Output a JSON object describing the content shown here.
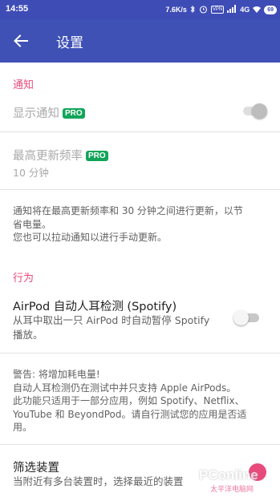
{
  "status_bar": {
    "time": "14:55",
    "net_speed": "7.6K/s",
    "vpn": "VPN",
    "network": "4G",
    "battery": "69"
  },
  "app_bar": {
    "title": "设置"
  },
  "sections": {
    "notifications": {
      "header": "通知",
      "show_notification": {
        "label": "显示通知",
        "badge": "PRO",
        "enabled": false
      },
      "max_frequency": {
        "label": "最高更新频率",
        "badge": "PRO",
        "value": "10 分钟"
      },
      "note_lines": [
        "通知将在最高更新频率和 30 分钟之间进行更新，以节",
        "省电量。",
        "您也可以拉动通知以进行手动更新。"
      ]
    },
    "behavior": {
      "header": "行为",
      "airpod_ear_detect": {
        "label": "AirPod 自动人耳检测 (Spotify)",
        "description_lines": [
          "从耳中取出一只 AirPod 时自动暂停 Spotify",
          "播放。"
        ],
        "checked": false
      },
      "warning_lines": [
        "警告: 将增加耗电量!",
        "自动人耳检测仍在测试中并只支持 Apple AirPods。",
        "此功能只适用于一部分应用，例如 Spotify、Netflix、",
        "YouTube 和 BeyondPod。请自行测试您的应用是否适",
        "用。"
      ],
      "filter_devices": {
        "label": "筛选装置",
        "description": "当附近有多台装置时，选择最近的装置"
      }
    }
  },
  "watermark": {
    "brand": "PConline",
    "sub": "太平洋电脑网"
  },
  "colors": {
    "status_bar": "#3e4cb6",
    "app_bar": "#3f51b5",
    "accent": "#e84a7c",
    "pro_badge": "#12a55a"
  }
}
